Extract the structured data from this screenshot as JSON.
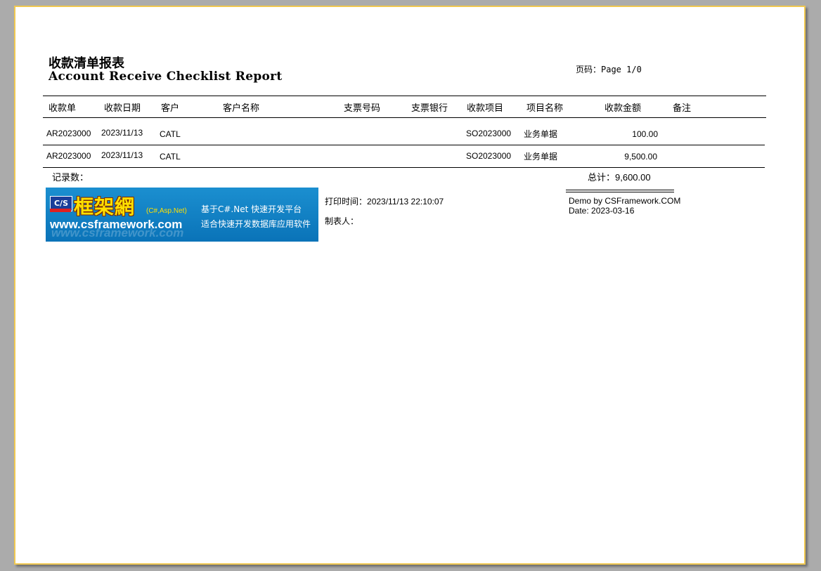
{
  "report": {
    "title_cn": "收款清单报表",
    "title_en": "Account Receive Checklist Report",
    "page_label": "页码：Page 1/0"
  },
  "columns": [
    "收款单",
    "收款日期",
    "客户",
    "客户名称",
    "支票号码",
    "支票银行",
    "收款项目",
    "项目名称",
    "收款金额",
    "备注"
  ],
  "rows": [
    {
      "doc_no": "AR2023000",
      "date": "2023/11/13",
      "customer": "CATL",
      "customer_name": "",
      "cheque_no": "",
      "cheque_bank": "",
      "item": "SO2023000",
      "item_name": "业务单据",
      "amount": "100.00",
      "remark": ""
    },
    {
      "doc_no": "AR2023000",
      "date": "2023/11/13",
      "customer": "CATL",
      "customer_name": "",
      "cheque_no": "",
      "cheque_bank": "",
      "item": "SO2023000",
      "item_name": "业务单据",
      "amount": "9,500.00",
      "remark": ""
    }
  ],
  "summary": {
    "record_count_label": "记录数：",
    "total_label": "总计：9,600.00"
  },
  "banner": {
    "logo_text": "C/S",
    "brand_cn": "框架網",
    "brand_sub": "(C#,Asp.Net)",
    "url": "www.csframework.com",
    "slogan1": "基于C#.Net 快速开发平台",
    "slogan2": "适合快速开发数据库应用软件"
  },
  "footer": {
    "print_time_label": "打印时间：",
    "print_time_value": "2023/11/13 22:10:07",
    "maker_label": "制表人：",
    "demo_by": "Demo by CSFramework.COM",
    "demo_date": "Date: 2023-03-16"
  },
  "colors": {
    "page_border": "#f0c850",
    "backdrop": "#ababab",
    "banner_blue": "#0a73b8",
    "brand_yellow": "#ffe000"
  }
}
